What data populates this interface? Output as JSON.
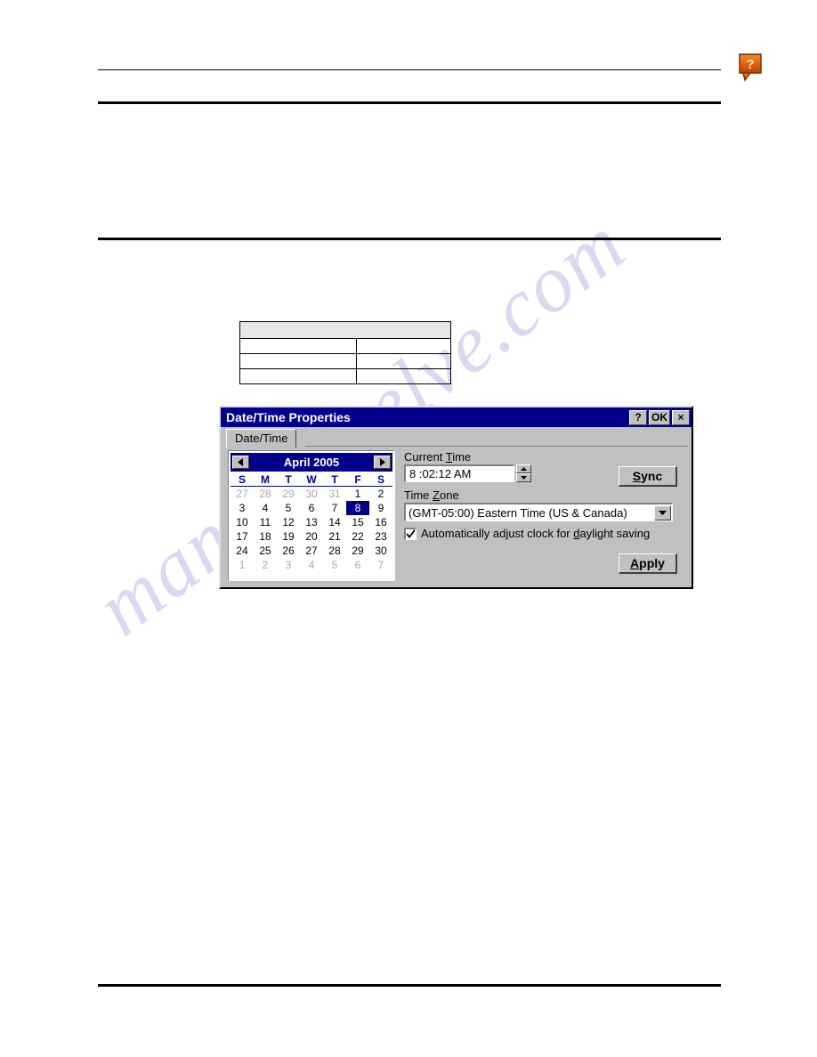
{
  "page": {
    "help_icon": "help-callout-icon",
    "watermark_text": "manualshelve.com"
  },
  "doc_table": {
    "rows": [
      {
        "cells": [
          "",
          ""
        ],
        "header": true
      },
      {
        "cells": [
          "",
          ""
        ],
        "header": false
      },
      {
        "cells": [
          "",
          ""
        ],
        "header": false
      },
      {
        "cells": [
          "",
          ""
        ],
        "header": false
      }
    ]
  },
  "dialog": {
    "title": "Date/Time Properties",
    "titlebar_buttons": {
      "help": "?",
      "ok": "OK",
      "close": "×"
    },
    "tabs": [
      {
        "label": "Date/Time",
        "active": true
      }
    ],
    "calendar": {
      "month_title": "April 2005",
      "prev_icon": "left-arrow-icon",
      "next_icon": "right-arrow-icon",
      "weekday_headers": [
        "S",
        "M",
        "T",
        "W",
        "T",
        "F",
        "S"
      ],
      "selected_day": 8,
      "weeks": [
        [
          {
            "d": "27",
            "other": true
          },
          {
            "d": "28",
            "other": true
          },
          {
            "d": "29",
            "other": true
          },
          {
            "d": "30",
            "other": true
          },
          {
            "d": "31",
            "other": true
          },
          {
            "d": "1",
            "other": false
          },
          {
            "d": "2",
            "other": false
          }
        ],
        [
          {
            "d": "3",
            "other": false
          },
          {
            "d": "4",
            "other": false
          },
          {
            "d": "5",
            "other": false
          },
          {
            "d": "6",
            "other": false
          },
          {
            "d": "7",
            "other": false
          },
          {
            "d": "8",
            "other": false,
            "sel": true
          },
          {
            "d": "9",
            "other": false
          }
        ],
        [
          {
            "d": "10",
            "other": false
          },
          {
            "d": "11",
            "other": false
          },
          {
            "d": "12",
            "other": false
          },
          {
            "d": "13",
            "other": false
          },
          {
            "d": "14",
            "other": false
          },
          {
            "d": "15",
            "other": false
          },
          {
            "d": "16",
            "other": false
          }
        ],
        [
          {
            "d": "17",
            "other": false
          },
          {
            "d": "18",
            "other": false
          },
          {
            "d": "19",
            "other": false
          },
          {
            "d": "20",
            "other": false
          },
          {
            "d": "21",
            "other": false
          },
          {
            "d": "22",
            "other": false
          },
          {
            "d": "23",
            "other": false
          }
        ],
        [
          {
            "d": "24",
            "other": false
          },
          {
            "d": "25",
            "other": false
          },
          {
            "d": "26",
            "other": false
          },
          {
            "d": "27",
            "other": false
          },
          {
            "d": "28",
            "other": false
          },
          {
            "d": "29",
            "other": false
          },
          {
            "d": "30",
            "other": false
          }
        ],
        [
          {
            "d": "1",
            "other": true
          },
          {
            "d": "2",
            "other": true
          },
          {
            "d": "3",
            "other": true
          },
          {
            "d": "4",
            "other": true
          },
          {
            "d": "5",
            "other": true
          },
          {
            "d": "6",
            "other": true
          },
          {
            "d": "7",
            "other": true
          }
        ]
      ]
    },
    "current_time": {
      "label_pre": "Current ",
      "label_accel": "T",
      "label_post": "ime",
      "value": "8 :02:12 AM",
      "spin_up_icon": "spin-up-icon",
      "spin_down_icon": "spin-down-icon"
    },
    "time_zone": {
      "label_pre": "Time ",
      "label_accel": "Z",
      "label_post": "one",
      "selected": "(GMT-05:00) Eastern Time (US & Canada)",
      "dropdown_icon": "chevron-down-icon"
    },
    "daylight_checkbox": {
      "checked": true,
      "label_pre": "Automatically adjust clock for ",
      "label_accel": "d",
      "label_post": "aylight saving"
    },
    "buttons": {
      "sync_pre": "",
      "sync_accel": "S",
      "sync_post": "ync",
      "apply_pre": "",
      "apply_accel": "A",
      "apply_post": "pply"
    },
    "colors": {
      "titlebar": "#00008b",
      "face": "#c0c0c0",
      "selected_day_bg": "#00008b",
      "weekday_header": "#00008b",
      "grayed_day": "#a8a8a8"
    }
  }
}
